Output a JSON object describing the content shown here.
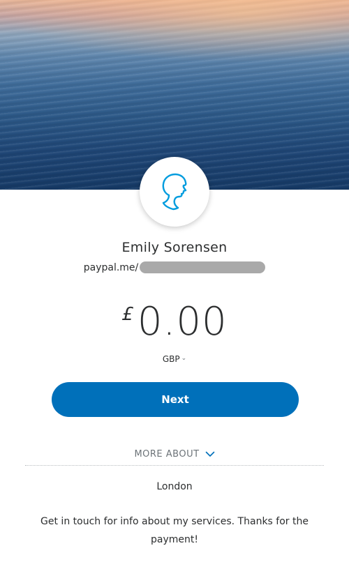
{
  "profile": {
    "name": "Emily Sorensen",
    "link_prefix": "paypal.me/",
    "location": "London",
    "bio": "Get in touch for info about my services. Thanks for the payment!"
  },
  "payment": {
    "currency_symbol": "£",
    "amount": "0.00",
    "currency_code": "GBP"
  },
  "actions": {
    "next_label": "Next",
    "more_about_label": "MORE ABOUT"
  },
  "colors": {
    "accent": "#0070ba",
    "avatar_icon": "#009cde"
  },
  "icons": {
    "avatar": "person-head-silhouette-icon",
    "currency_dropdown": "chevron-down-icon",
    "more_about": "chevron-down-icon"
  }
}
